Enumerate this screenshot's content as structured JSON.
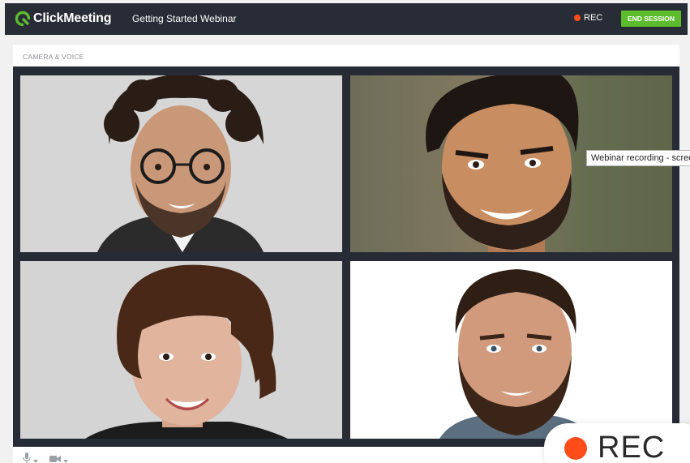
{
  "header": {
    "logo_text": "ClickMeeting",
    "title": "Getting Started Webinar",
    "rec_label": "REC",
    "end_session_label": "END SESSION"
  },
  "panel": {
    "title": "CAMERA & VOICE"
  },
  "tooltip": {
    "text": "Webinar recording - screen"
  },
  "rec_badge": {
    "label": "REC"
  },
  "colors": {
    "header_bg": "#272c36",
    "accent_green": "#5dbb2e",
    "rec_red": "#ff4d1a",
    "grid_bg": "#262b35"
  }
}
